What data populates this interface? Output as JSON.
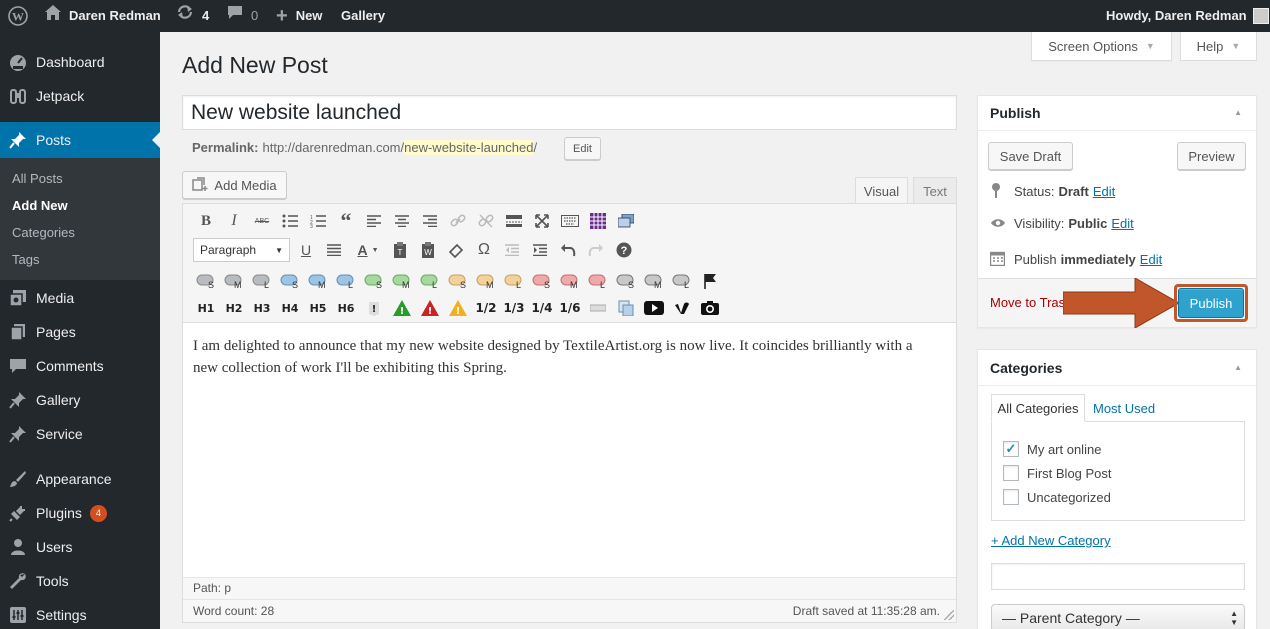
{
  "adminbar": {
    "site_name": "Daren Redman",
    "updates_count": "4",
    "comments_count": "0",
    "new_label": "New",
    "gallery_label": "Gallery",
    "howdy": "Howdy, Daren Redman"
  },
  "sidebar": {
    "items": [
      {
        "label": "Dashboard",
        "icon": "dashboard-icon"
      },
      {
        "label": "Jetpack",
        "icon": "jetpack-icon"
      },
      {
        "label": "Posts",
        "icon": "pin-icon"
      },
      {
        "label": "Media",
        "icon": "media-icon"
      },
      {
        "label": "Pages",
        "icon": "pages-icon"
      },
      {
        "label": "Comments",
        "icon": "comments-icon"
      },
      {
        "label": "Gallery",
        "icon": "pin-icon"
      },
      {
        "label": "Service",
        "icon": "pin-icon"
      },
      {
        "label": "Appearance",
        "icon": "brush-icon"
      },
      {
        "label": "Plugins",
        "icon": "plug-icon"
      },
      {
        "label": "Users",
        "icon": "users-icon"
      },
      {
        "label": "Tools",
        "icon": "wrench-icon"
      },
      {
        "label": "Settings",
        "icon": "settings-icon"
      }
    ],
    "posts_sub": [
      "All Posts",
      "Add New",
      "Categories",
      "Tags"
    ],
    "plugins_badge": "4"
  },
  "screen_options": "Screen Options",
  "help": "Help",
  "page_title": "Add New Post",
  "post_title": "New website launched",
  "permalink": {
    "label": "Permalink:",
    "base": "http://darenredman.com/",
    "slug": "new-website-launched",
    "trail": "/",
    "edit": "Edit"
  },
  "add_media": "Add Media",
  "tabs": {
    "visual": "Visual",
    "text": "Text"
  },
  "toolbar": {
    "format_select": "Paragraph",
    "headings": [
      "H1",
      "H2",
      "H3",
      "H4",
      "H5",
      "H6"
    ],
    "fractions": [
      "1/2",
      "1/3",
      "1/4",
      "1/6"
    ]
  },
  "content": "I am delighted to announce that my new website designed by TextileArtist.org is now live. It coincides brilliantly with a new collection of work I'll be exhibiting this Spring.",
  "status_bar": {
    "path": "Path: p",
    "word_count": "Word count: 28",
    "draft_saved": "Draft saved at 11:35:28 am."
  },
  "publish_box": {
    "title": "Publish",
    "save_draft": "Save Draft",
    "preview": "Preview",
    "status_label": "Status:",
    "status_value": "Draft",
    "visibility_label": "Visibility:",
    "visibility_value": "Public",
    "publish_label": "Publish",
    "publish_value": "immediately",
    "edit": "Edit",
    "trash": "Move to Tras",
    "publish_button": "Publish"
  },
  "categories_box": {
    "title": "Categories",
    "tab_all": "All Categories",
    "tab_most": "Most Used",
    "items": [
      {
        "label": "My art online",
        "checked": true
      },
      {
        "label": "First Blog Post",
        "checked": false
      },
      {
        "label": "Uncategorized",
        "checked": false
      }
    ],
    "add_new": "+ Add New Category",
    "parent": "— Parent Category —"
  },
  "colors": {
    "adminbar": "#23282d",
    "accent": "#0073aa",
    "menu_active": "#0073aa",
    "publish_button": "#2ea2cc",
    "annotation_arrow": "#c0562a",
    "trash": "#a00",
    "badge": "#d54e21"
  }
}
